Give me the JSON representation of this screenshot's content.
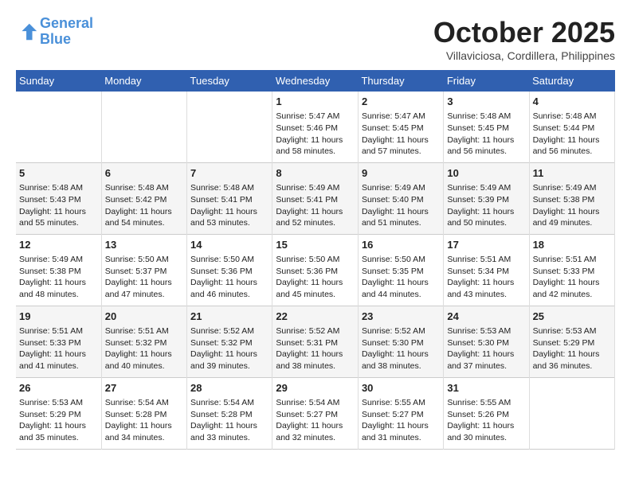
{
  "header": {
    "logo_line1": "General",
    "logo_line2": "Blue",
    "month": "October 2025",
    "location": "Villaviciosa, Cordillera, Philippines"
  },
  "weekdays": [
    "Sunday",
    "Monday",
    "Tuesday",
    "Wednesday",
    "Thursday",
    "Friday",
    "Saturday"
  ],
  "weeks": [
    [
      {
        "day": "",
        "content": ""
      },
      {
        "day": "",
        "content": ""
      },
      {
        "day": "",
        "content": ""
      },
      {
        "day": "1",
        "content": "Sunrise: 5:47 AM\nSunset: 5:46 PM\nDaylight: 11 hours and 58 minutes."
      },
      {
        "day": "2",
        "content": "Sunrise: 5:47 AM\nSunset: 5:45 PM\nDaylight: 11 hours and 57 minutes."
      },
      {
        "day": "3",
        "content": "Sunrise: 5:48 AM\nSunset: 5:45 PM\nDaylight: 11 hours and 56 minutes."
      },
      {
        "day": "4",
        "content": "Sunrise: 5:48 AM\nSunset: 5:44 PM\nDaylight: 11 hours and 56 minutes."
      }
    ],
    [
      {
        "day": "5",
        "content": "Sunrise: 5:48 AM\nSunset: 5:43 PM\nDaylight: 11 hours and 55 minutes."
      },
      {
        "day": "6",
        "content": "Sunrise: 5:48 AM\nSunset: 5:42 PM\nDaylight: 11 hours and 54 minutes."
      },
      {
        "day": "7",
        "content": "Sunrise: 5:48 AM\nSunset: 5:41 PM\nDaylight: 11 hours and 53 minutes."
      },
      {
        "day": "8",
        "content": "Sunrise: 5:49 AM\nSunset: 5:41 PM\nDaylight: 11 hours and 52 minutes."
      },
      {
        "day": "9",
        "content": "Sunrise: 5:49 AM\nSunset: 5:40 PM\nDaylight: 11 hours and 51 minutes."
      },
      {
        "day": "10",
        "content": "Sunrise: 5:49 AM\nSunset: 5:39 PM\nDaylight: 11 hours and 50 minutes."
      },
      {
        "day": "11",
        "content": "Sunrise: 5:49 AM\nSunset: 5:38 PM\nDaylight: 11 hours and 49 minutes."
      }
    ],
    [
      {
        "day": "12",
        "content": "Sunrise: 5:49 AM\nSunset: 5:38 PM\nDaylight: 11 hours and 48 minutes."
      },
      {
        "day": "13",
        "content": "Sunrise: 5:50 AM\nSunset: 5:37 PM\nDaylight: 11 hours and 47 minutes."
      },
      {
        "day": "14",
        "content": "Sunrise: 5:50 AM\nSunset: 5:36 PM\nDaylight: 11 hours and 46 minutes."
      },
      {
        "day": "15",
        "content": "Sunrise: 5:50 AM\nSunset: 5:36 PM\nDaylight: 11 hours and 45 minutes."
      },
      {
        "day": "16",
        "content": "Sunrise: 5:50 AM\nSunset: 5:35 PM\nDaylight: 11 hours and 44 minutes."
      },
      {
        "day": "17",
        "content": "Sunrise: 5:51 AM\nSunset: 5:34 PM\nDaylight: 11 hours and 43 minutes."
      },
      {
        "day": "18",
        "content": "Sunrise: 5:51 AM\nSunset: 5:33 PM\nDaylight: 11 hours and 42 minutes."
      }
    ],
    [
      {
        "day": "19",
        "content": "Sunrise: 5:51 AM\nSunset: 5:33 PM\nDaylight: 11 hours and 41 minutes."
      },
      {
        "day": "20",
        "content": "Sunrise: 5:51 AM\nSunset: 5:32 PM\nDaylight: 11 hours and 40 minutes."
      },
      {
        "day": "21",
        "content": "Sunrise: 5:52 AM\nSunset: 5:32 PM\nDaylight: 11 hours and 39 minutes."
      },
      {
        "day": "22",
        "content": "Sunrise: 5:52 AM\nSunset: 5:31 PM\nDaylight: 11 hours and 38 minutes."
      },
      {
        "day": "23",
        "content": "Sunrise: 5:52 AM\nSunset: 5:30 PM\nDaylight: 11 hours and 38 minutes."
      },
      {
        "day": "24",
        "content": "Sunrise: 5:53 AM\nSunset: 5:30 PM\nDaylight: 11 hours and 37 minutes."
      },
      {
        "day": "25",
        "content": "Sunrise: 5:53 AM\nSunset: 5:29 PM\nDaylight: 11 hours and 36 minutes."
      }
    ],
    [
      {
        "day": "26",
        "content": "Sunrise: 5:53 AM\nSunset: 5:29 PM\nDaylight: 11 hours and 35 minutes."
      },
      {
        "day": "27",
        "content": "Sunrise: 5:54 AM\nSunset: 5:28 PM\nDaylight: 11 hours and 34 minutes."
      },
      {
        "day": "28",
        "content": "Sunrise: 5:54 AM\nSunset: 5:28 PM\nDaylight: 11 hours and 33 minutes."
      },
      {
        "day": "29",
        "content": "Sunrise: 5:54 AM\nSunset: 5:27 PM\nDaylight: 11 hours and 32 minutes."
      },
      {
        "day": "30",
        "content": "Sunrise: 5:55 AM\nSunset: 5:27 PM\nDaylight: 11 hours and 31 minutes."
      },
      {
        "day": "31",
        "content": "Sunrise: 5:55 AM\nSunset: 5:26 PM\nDaylight: 11 hours and 30 minutes."
      },
      {
        "day": "",
        "content": ""
      }
    ]
  ]
}
